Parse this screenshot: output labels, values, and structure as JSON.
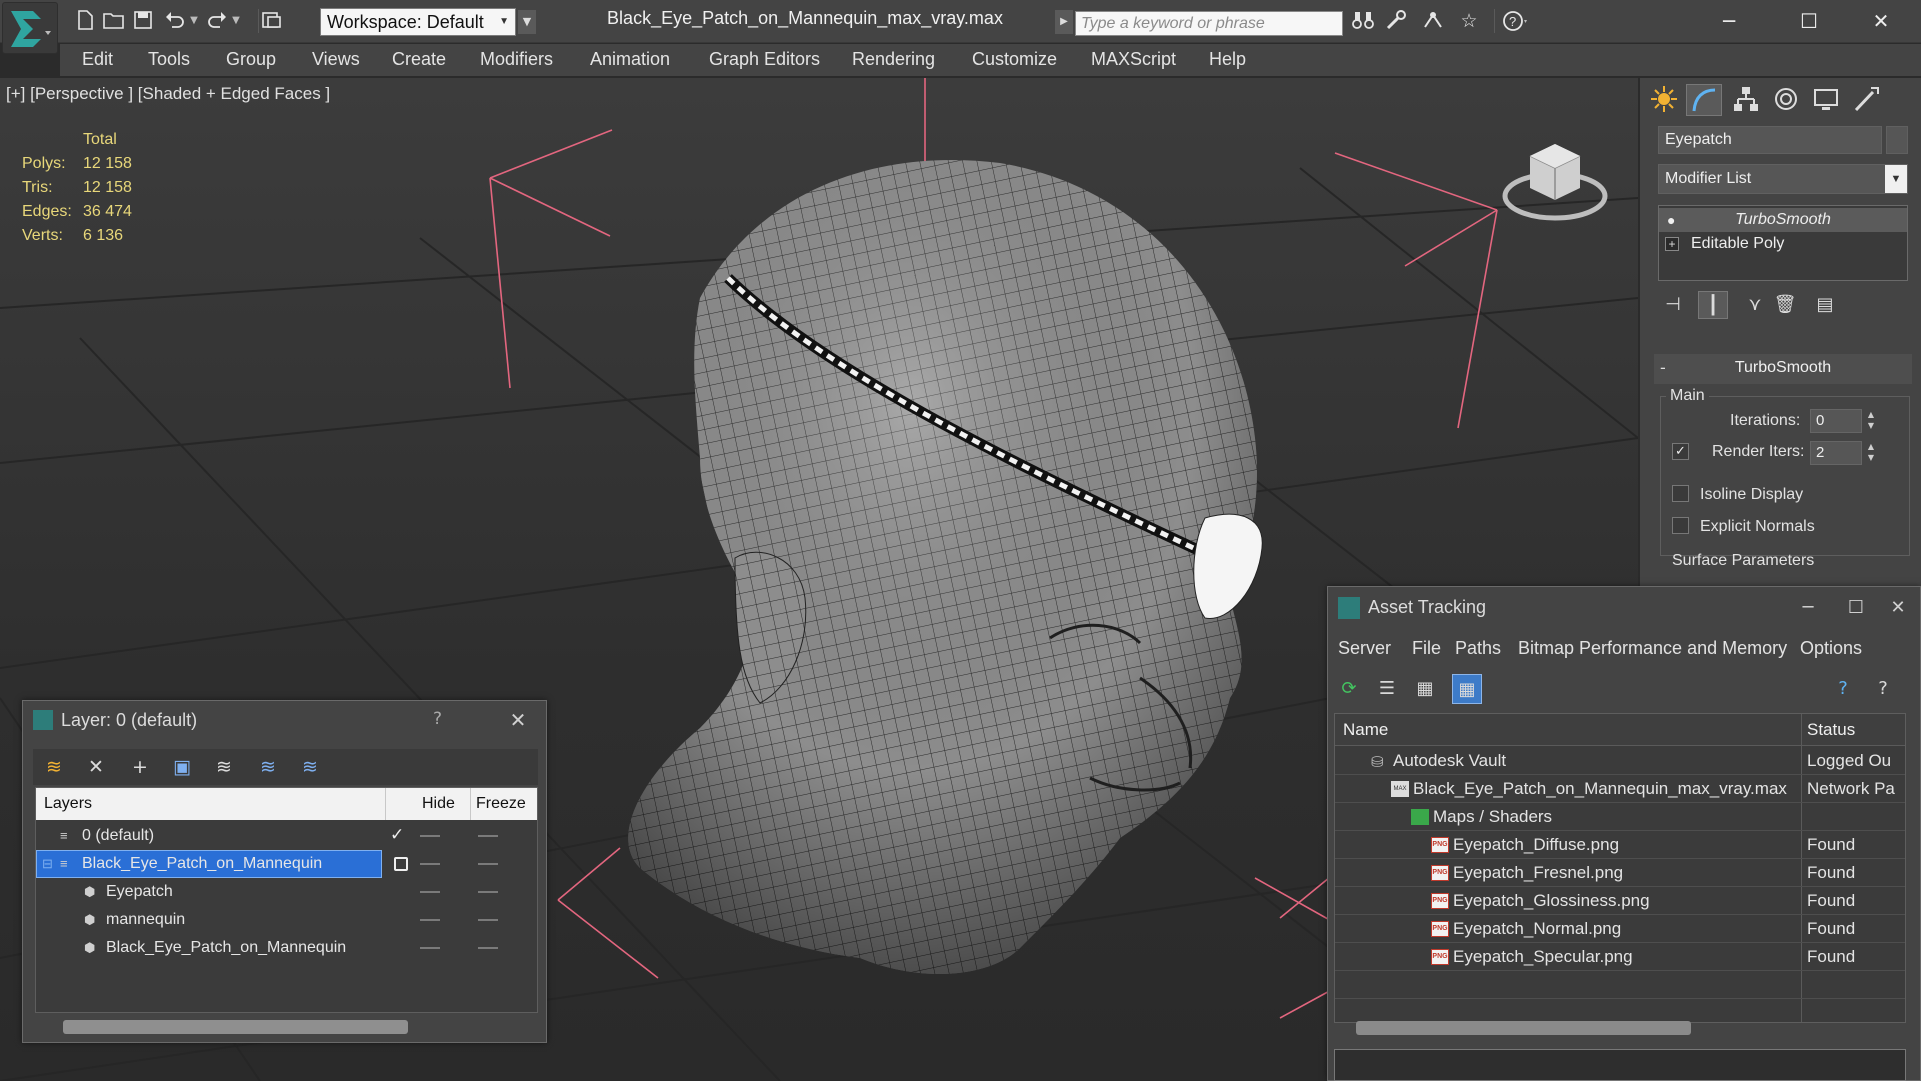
{
  "titlebar": {
    "workspace": "Workspace: Default",
    "document_title": "Black_Eye_Patch_on_Mannequin_max_vray.max",
    "search_placeholder": "Type a keyword or phrase"
  },
  "menu": [
    "Edit",
    "Tools",
    "Group",
    "Views",
    "Create",
    "Modifiers",
    "Animation",
    "Graph Editors",
    "Rendering",
    "Customize",
    "MAXScript",
    "Help"
  ],
  "viewport": {
    "label": "[+] [Perspective ] [Shaded + Edged Faces ]",
    "stats": {
      "header": "Total",
      "rows": [
        {
          "label": "Polys:",
          "value": "12 158"
        },
        {
          "label": "Tris:",
          "value": "12 158"
        },
        {
          "label": "Edges:",
          "value": "36 474"
        },
        {
          "label": "Verts:",
          "value": "6 136"
        }
      ]
    }
  },
  "command_panel": {
    "object_name": "Eyepatch",
    "modifier_list": "Modifier List",
    "stack": [
      {
        "label": "TurboSmooth",
        "selected": true
      },
      {
        "label": "Editable Poly",
        "selected": false
      }
    ],
    "rollout_title": "TurboSmooth",
    "main_group": "Main",
    "iterations_label": "Iterations:",
    "iterations_value": "0",
    "render_iters_label": "Render Iters:",
    "render_iters_value": "2",
    "isoline_label": "Isoline Display",
    "explicit_normals_label": "Explicit Normals",
    "surface_params_label": "Surface Parameters"
  },
  "asset_tracking": {
    "title": "Asset Tracking",
    "menu": [
      "Server",
      "File",
      "Paths",
      "Bitmap Performance and Memory",
      "Options"
    ],
    "columns": {
      "name": "Name",
      "status": "Status"
    },
    "rows": [
      {
        "name": "Autodesk Vault",
        "status": "Logged Ou"
      },
      {
        "name": "Black_Eye_Patch_on_Mannequin_max_vray.max",
        "status": "Network Pa"
      },
      {
        "name": "Maps / Shaders",
        "status": ""
      },
      {
        "name": "Eyepatch_Diffuse.png",
        "status": "Found"
      },
      {
        "name": "Eyepatch_Fresnel.png",
        "status": "Found"
      },
      {
        "name": "Eyepatch_Glossiness.png",
        "status": "Found"
      },
      {
        "name": "Eyepatch_Normal.png",
        "status": "Found"
      },
      {
        "name": "Eyepatch_Specular.png",
        "status": "Found"
      }
    ]
  },
  "layer_manager": {
    "title": "Layer: 0 (default)",
    "help": "?",
    "columns": {
      "layers": "Layers",
      "hide": "Hide",
      "freeze": "Freeze"
    },
    "rows": [
      {
        "name": "0 (default)",
        "checked": true
      },
      {
        "name": "Black_Eye_Patch_on_Mannequin",
        "selected": true
      },
      {
        "name": "Eyepatch"
      },
      {
        "name": "mannequin"
      },
      {
        "name": "Black_Eye_Patch_on_Mannequin"
      }
    ]
  },
  "icons": {
    "app": "3ds-max-logo-icon",
    "search": "binoculars-icon",
    "render": "teapot-icon"
  },
  "colors": {
    "accent_selection": "#2a6fd6",
    "stats_text": "#e8d77a",
    "ui_background": "#444444"
  }
}
